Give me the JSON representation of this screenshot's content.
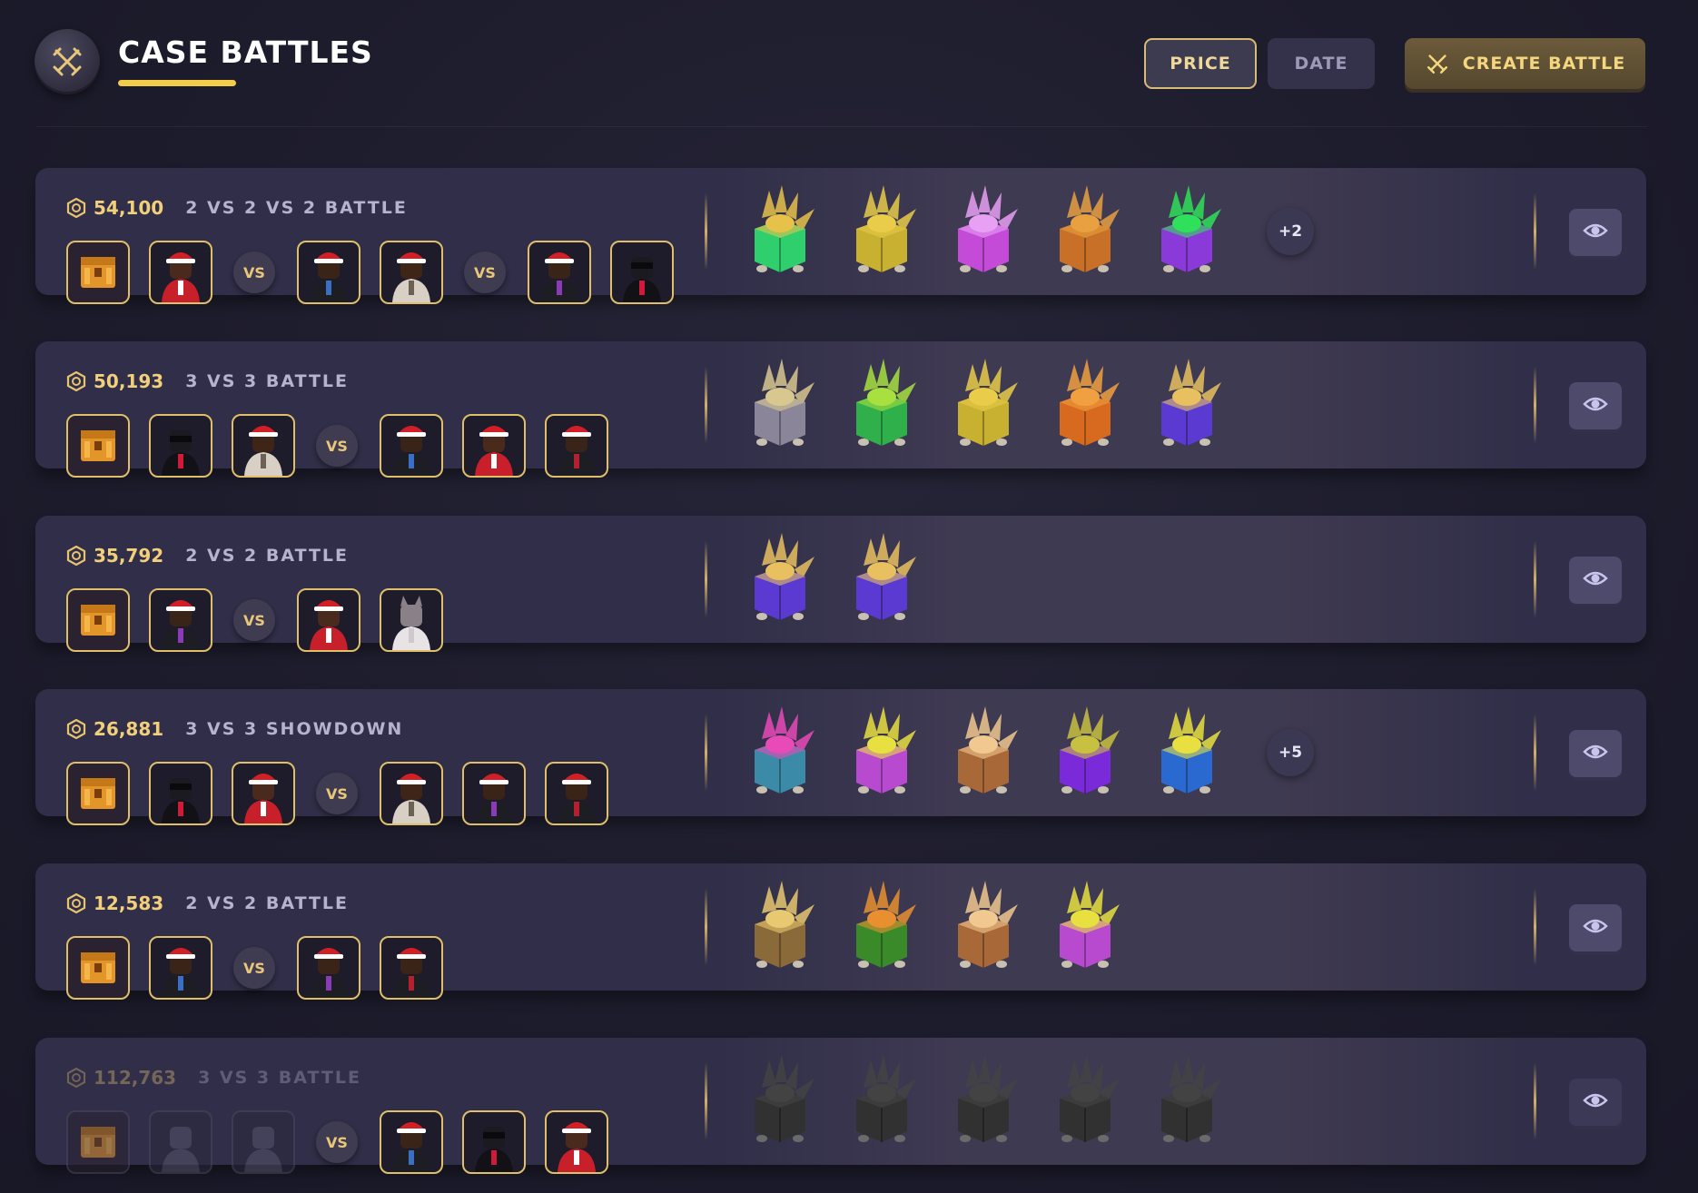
{
  "header": {
    "title": "CASE BATTLES",
    "sort_price_label": "PRICE",
    "sort_date_label": "DATE",
    "create_label": "CREATE BATTLE"
  },
  "colors": {
    "accent_gold": "#f3cc4a",
    "row_bg": "#302e48",
    "page_bg": "#1d1c2c"
  },
  "battles": [
    {
      "price": "54,100",
      "mode": "2 VS 2 VS 2 BATTLE",
      "teams": [
        [
          {
            "kind": "case"
          },
          {
            "kind": "santa-red"
          }
        ],
        [
          {
            "kind": "santa-dark"
          },
          {
            "kind": "santa-plaid"
          }
        ],
        [
          {
            "kind": "santa-purple"
          },
          {
            "kind": "masked-suit"
          }
        ]
      ],
      "vs_label": "VS",
      "cases": [
        "green-hat-case",
        "gold-cowboy-case",
        "pink-face-case",
        "orange-hat-case",
        "purple-mask-case"
      ],
      "more": "+2",
      "dim": false
    },
    {
      "price": "50,193",
      "mode": "3 VS 3 BATTLE",
      "teams": [
        [
          {
            "kind": "case"
          },
          {
            "kind": "masked-suit"
          },
          {
            "kind": "santa-plaid"
          }
        ],
        [
          {
            "kind": "santa-dark"
          },
          {
            "kind": "santa-red"
          },
          {
            "kind": "santa-darkred"
          }
        ]
      ],
      "vs_label": "VS",
      "cases": [
        "silver-case",
        "green-case",
        "gold-cowboy-case",
        "orange-case",
        "halo-case"
      ],
      "more": "",
      "dim": false
    },
    {
      "price": "35,792",
      "mode": "2 VS 2 BATTLE",
      "teams": [
        [
          {
            "kind": "case"
          },
          {
            "kind": "santa-purple"
          }
        ],
        [
          {
            "kind": "santa-red"
          },
          {
            "kind": "wolf-white"
          }
        ]
      ],
      "vs_label": "VS",
      "cases": [
        "halo-case",
        "halo-case"
      ],
      "more": "",
      "dim": false
    },
    {
      "price": "26,881",
      "mode": "3 VS 3 SHOWDOWN",
      "teams": [
        [
          {
            "kind": "case"
          },
          {
            "kind": "masked-suit"
          },
          {
            "kind": "santa-red"
          }
        ],
        [
          {
            "kind": "santa-plaid"
          },
          {
            "kind": "santa-purple"
          },
          {
            "kind": "santa-darkred"
          }
        ]
      ],
      "vs_label": "VS",
      "cases": [
        "pink-hat-case",
        "yellow-pink-case",
        "halo-orange-case",
        "purple-wing-case",
        "blue-hat-case"
      ],
      "more": "+5",
      "dim": false
    },
    {
      "price": "12,583",
      "mode": "2 VS 2 BATTLE",
      "teams": [
        [
          {
            "kind": "case"
          },
          {
            "kind": "santa-dark"
          }
        ],
        [
          {
            "kind": "santa-purple"
          },
          {
            "kind": "santa-darkred"
          }
        ]
      ],
      "vs_label": "VS",
      "cases": [
        "phone-case",
        "orange-ball-case",
        "halo-orange-case",
        "yellow-pink-case"
      ],
      "more": "",
      "dim": false
    },
    {
      "price": "112,763",
      "mode": "3 VS 3 BATTLE",
      "teams": [
        [
          {
            "kind": "case",
            "faded": true
          },
          {
            "kind": "empty",
            "faded": true
          },
          {
            "kind": "empty",
            "faded": true
          }
        ],
        [
          {
            "kind": "santa-dark"
          },
          {
            "kind": "masked-suit"
          },
          {
            "kind": "santa-red"
          }
        ]
      ],
      "vs_label": "VS",
      "cases": [
        "gray-case",
        "gray-case",
        "gray-case",
        "gray-case",
        "gray-case"
      ],
      "more": "",
      "dim": true
    }
  ]
}
